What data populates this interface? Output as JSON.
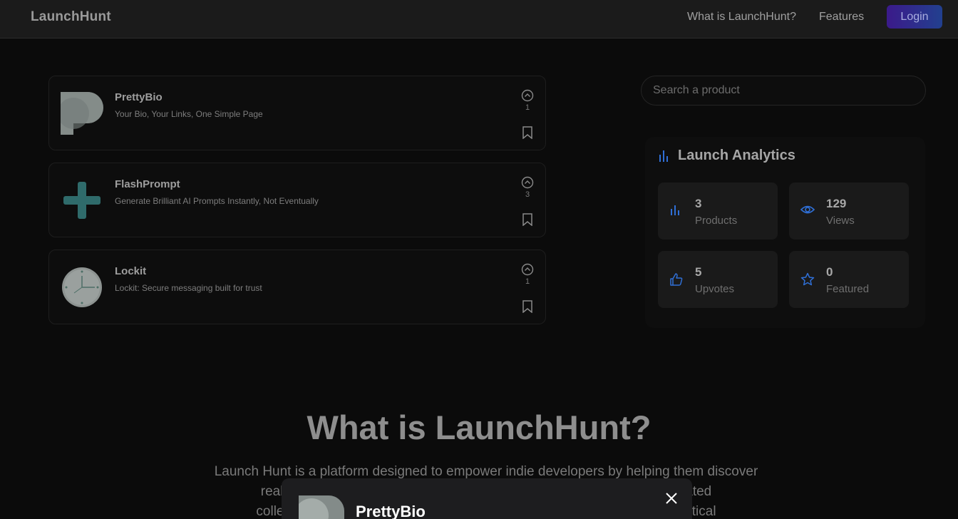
{
  "navbar": {
    "brand": "LaunchHunt",
    "links": [
      "What is LaunchHunt?",
      "Features"
    ],
    "login_label": "Login"
  },
  "products": [
    {
      "name": "PrettyBio",
      "tagline": "Your Bio, Your Links, One Simple Page",
      "upvotes": "1",
      "logo": "prettybio-logo"
    },
    {
      "name": "FlashPrompt",
      "tagline": "Generate Brilliant AI Prompts Instantly, Not Eventually",
      "upvotes": "3",
      "logo": "plus-logo"
    },
    {
      "name": "Lockit",
      "tagline": "Lockit: Secure messaging built for trust",
      "upvotes": "1",
      "logo": "clock-logo"
    }
  ],
  "search": {
    "placeholder": "Search a product"
  },
  "analytics": {
    "title": "Launch Analytics",
    "stats": [
      {
        "value": "3",
        "label": "Products",
        "icon": "bar-chart-icon"
      },
      {
        "value": "129",
        "label": "Views",
        "icon": "eye-icon"
      },
      {
        "value": "5",
        "label": "Upvotes",
        "icon": "thumbs-up-icon"
      },
      {
        "value": "0",
        "label": "Featured",
        "icon": "star-icon"
      }
    ]
  },
  "about": {
    "title": "What is LaunchHunt?",
    "line1": "Launch Hunt is a platform designed to empower indie developers by helping them discover",
    "line2": "real-world p                                                                                  to a curated",
    "line3": "collection of                                                                                    ain practical"
  },
  "modal": {
    "product_name": "PrettyBio"
  },
  "colors": {
    "accent": "#2f6fd6",
    "brand_gradient_start": "#3b1a8a",
    "brand_gradient_end": "#22408f"
  }
}
